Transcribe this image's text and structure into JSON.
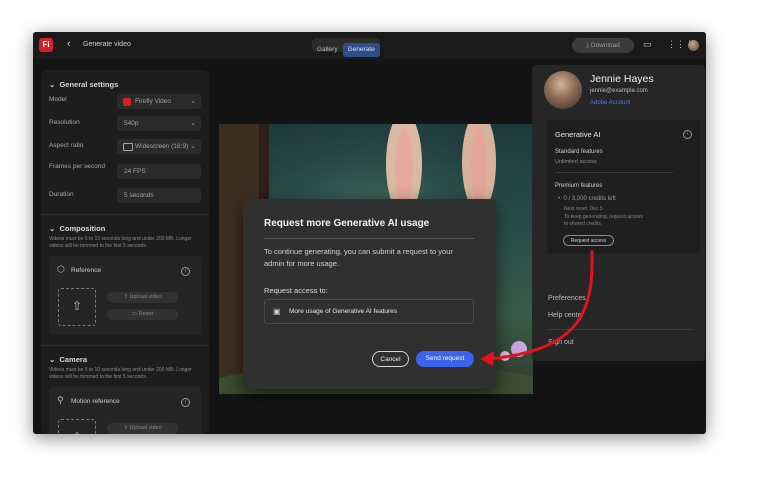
{
  "topbar": {
    "back_icon": "‹",
    "title": "Generate video",
    "tabs": [
      {
        "label": "Gallery"
      },
      {
        "label": "Generate"
      }
    ],
    "download_label": "Download"
  },
  "sidebar": {
    "general_title": "General settings",
    "fields": [
      {
        "label": "Model",
        "value": "Firefly Video"
      },
      {
        "label": "Resolution",
        "value": "540p"
      },
      {
        "label": "Aspect ratio",
        "value": "Widescreen (16:9)"
      },
      {
        "label": "Frames per second",
        "value": "24 FPS"
      },
      {
        "label": "Duration",
        "value": "5 seconds"
      }
    ],
    "composition_title": "Composition",
    "composition_note": "Videos must be 5 to 10 seconds long and under 200 MB. Longer videos will be trimmed to the first 5 seconds.",
    "reference_label": "Reference",
    "upload_video": "Upload video",
    "reset": "Reset",
    "camera_title": "Camera",
    "camera_note": "Videos must be 5 to 10 seconds long and under 200 MB. Longer videos will be trimmed to the first 5 seconds.",
    "motion_label": "Motion reference",
    "upload_video2": "Upload video"
  },
  "dialog": {
    "title": "Request more Generative AI usage",
    "body": "To continue generating, you can submit a request to your admin for more usage.",
    "request_label": "Request access to:",
    "option": "More usage of Generative AI features",
    "cancel": "Cancel",
    "send": "Send request"
  },
  "account": {
    "name": "Jennie Hayes",
    "email": "jennie@example.com",
    "adobe_account": "Adobe Account",
    "genai_title": "Generative AI",
    "standard": "Standard features",
    "unlimited": "Unlimited access",
    "premium": "Premium features",
    "credits": "0 / 3,000 credits left",
    "next_reset": "Next reset: Dec 5",
    "reset_note": "To keep generating, request access to shared credits",
    "request_access": "Request access",
    "preferences": "Preferences",
    "help": "Help center",
    "signout": "Sign out"
  },
  "colors": {
    "accent": "#3b63f0",
    "brand": "#d71f26",
    "arrow": "#e0141c"
  }
}
